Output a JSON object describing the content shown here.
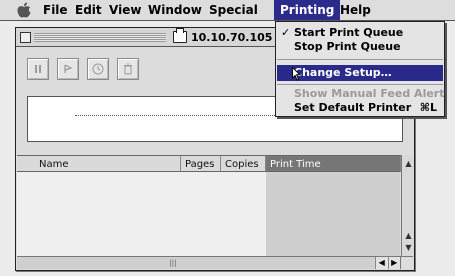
{
  "menubar": {
    "items": [
      {
        "label": "File"
      },
      {
        "label": "Edit"
      },
      {
        "label": "View"
      },
      {
        "label": "Window"
      },
      {
        "label": "Special"
      },
      {
        "label": "Printing"
      },
      {
        "label": "Help"
      }
    ]
  },
  "printing_menu": {
    "start_queue": "Start Print Queue",
    "start_check": "✓",
    "stop_queue": "Stop Print Queue",
    "change_setup": "Change Setup…",
    "manual_feed": "Show Manual Feed Alert",
    "default_printer": "Set Default Printer",
    "default_printer_shortcut": "⌘L"
  },
  "window": {
    "title": "10.10.70.105"
  },
  "columns": [
    {
      "label": "Name"
    },
    {
      "label": "Pages"
    },
    {
      "label": "Copies"
    },
    {
      "label": "Print Time"
    }
  ],
  "colors": {
    "highlight": "#2a2a8a",
    "sorted_header": "#767676"
  }
}
